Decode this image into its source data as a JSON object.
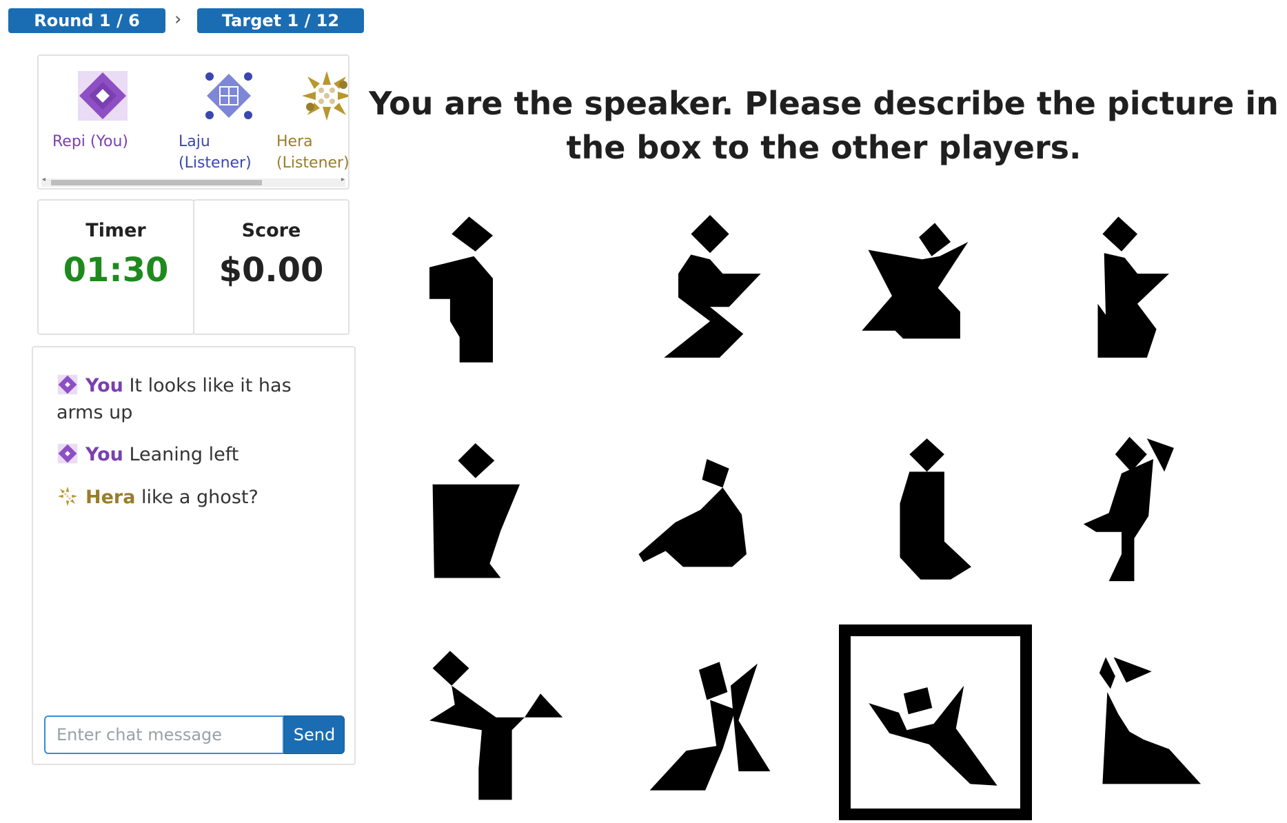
{
  "breadcrumb": {
    "round": "Round 1 / 6",
    "separator": "›",
    "target": "Target 1 / 12"
  },
  "players": [
    {
      "name": "Repi (You)",
      "color": "#7b3fb0",
      "icon": "purple-diamond-avatar-icon"
    },
    {
      "name": "Laju (Listener)",
      "color": "#3a47b0",
      "icon": "blue-grid-avatar-icon"
    },
    {
      "name": "Hera (Listener)",
      "color": "#9a7d2a",
      "icon": "gold-burst-avatar-icon"
    }
  ],
  "timer": {
    "label": "Timer",
    "value": "01:30"
  },
  "score": {
    "label": "Score",
    "value": "$0.00"
  },
  "chat": {
    "messages": [
      {
        "author": "You",
        "text": "It looks like it has arms up",
        "icon": "purple-diamond-avatar-icon"
      },
      {
        "author": "You",
        "text": "Leaning left",
        "icon": "purple-diamond-avatar-icon"
      },
      {
        "author": "Hera",
        "text": "like a ghost?",
        "icon": "gold-burst-avatar-icon"
      }
    ],
    "input_placeholder": "Enter chat message",
    "send_label": "Send"
  },
  "instruction": "You are the speaker. Please describe the picture in the box to the other players.",
  "tangrams": {
    "count": 12,
    "selected_index": 10,
    "icons": [
      "tangram-figure-icon"
    ]
  }
}
